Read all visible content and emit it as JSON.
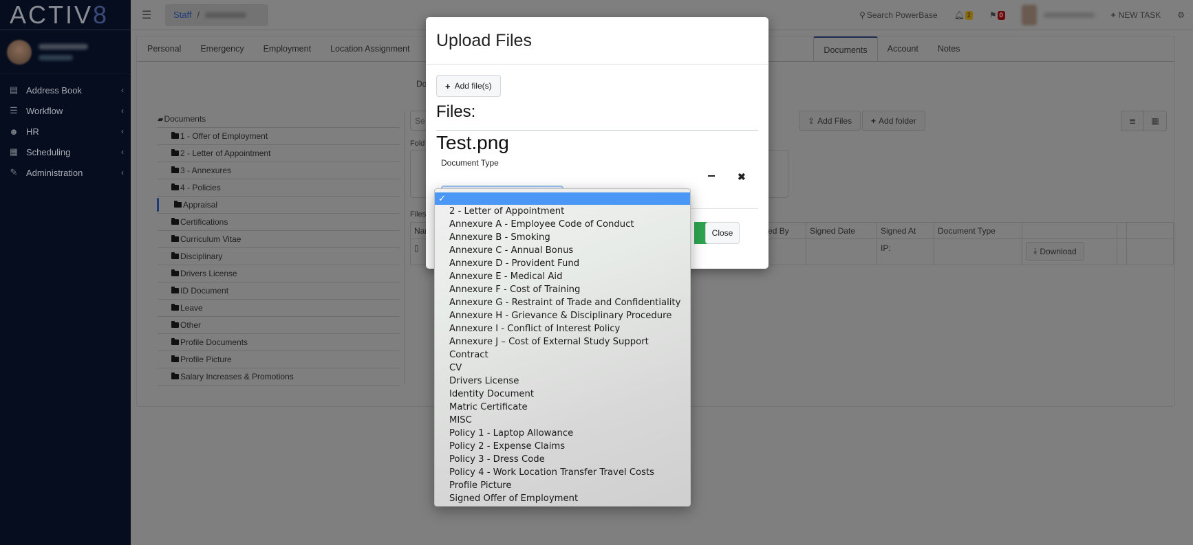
{
  "app": {
    "logo_main": "ACTIV",
    "logo_accent": "8"
  },
  "sidebar": {
    "items": [
      {
        "label": "Address Book",
        "icon": "book-icon"
      },
      {
        "label": "Workflow",
        "icon": "server-icon"
      },
      {
        "label": "HR",
        "icon": "users-icon"
      },
      {
        "label": "Scheduling",
        "icon": "calendar-icon"
      },
      {
        "label": "Administration",
        "icon": "wrench-icon"
      }
    ],
    "chevron": "‹"
  },
  "topbar": {
    "menu_icon": "☰",
    "breadcrumb_root": "Staff",
    "breadcrumb_sep": "/",
    "search_label": "Search PowerBase",
    "notifications_count": "2",
    "flags_count": "0",
    "new_task_label": "NEW TASK"
  },
  "tabs": [
    {
      "label": "Personal"
    },
    {
      "label": "Emergency"
    },
    {
      "label": "Employment"
    },
    {
      "label": "Location Assignment"
    },
    {
      "label": "Documents",
      "active": true
    },
    {
      "label": "Account"
    },
    {
      "label": "Notes"
    }
  ],
  "documents": {
    "section_label": "Do",
    "tree_root": "Documents",
    "folders": [
      "1 - Offer of Employment",
      "2 - Letter of Appointment",
      "3 - Annexures",
      "4 - Policies",
      "Appraisal",
      "Certifications",
      "Curriculum Vitae",
      "Disciplinary",
      "Drivers License",
      "ID Document",
      "Leave",
      "Other",
      "Profile Documents",
      "Profile Picture",
      "Salary Increases & Promotions"
    ],
    "active_folder": "Appraisal",
    "search_placeholder": "Se",
    "add_files_label": "Add Files",
    "add_folder_label": "Add folder",
    "folder_label": "Fold",
    "files_label": "Files",
    "table": {
      "columns": [
        "Nar",
        "Signed By",
        "Signed Date",
        "Signed At",
        "Document Type",
        "",
        "",
        ""
      ],
      "rows": [
        {
          "signed_by": "",
          "signed_date": "",
          "signed_at": "IP:",
          "document_type": "",
          "action": "Download"
        }
      ]
    }
  },
  "modal": {
    "title": "Upload Files",
    "add_file_label": "Add file(s)",
    "files_heading": "Files:",
    "file_name": "Test.png",
    "document_type_label": "Document Type",
    "close_label": "Close"
  },
  "dropdown": {
    "selected_index": 0,
    "options": [
      "",
      "2 - Letter of Appointment",
      "Annexure A - Employee Code of Conduct",
      "Annexure B - Smoking",
      "Annexure C - Annual Bonus",
      "Annexure D - Provident Fund",
      "Annexure E - Medical Aid",
      "Annexure F - Cost of Training",
      "Annexure G - Restraint of Trade and Confidentiality",
      "Annexure H - Grievance & Disciplinary Procedure",
      "Annexure I - Conflict of Interest Policy",
      "Annexure J – Cost of External Study Support",
      "Contract",
      "CV",
      "Drivers License",
      "Identity Document",
      "Matric Certificate",
      "MISC",
      "Policy 1 - Laptop Allowance",
      "Policy 2 - Expense Claims",
      "Policy 3 - Dress Code",
      "Policy 4 - Work Location Transfer Travel Costs",
      "Profile Picture",
      "Signed Offer of Employment"
    ]
  },
  "colors": {
    "sidebar_bg": "#050d1f",
    "overlay_bg": "#7f7f7f",
    "selected_option": "#4a97f6",
    "upload_green": "#2ea44f"
  }
}
